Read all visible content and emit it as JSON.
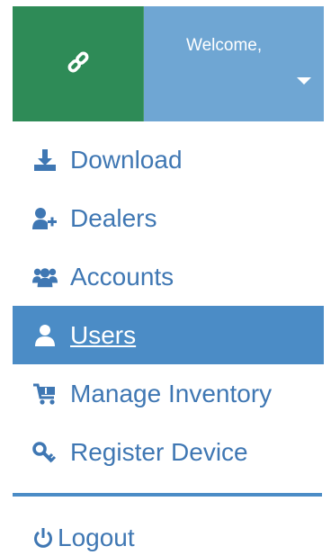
{
  "header": {
    "logo_icon": "link-icon",
    "welcome_text": "Welcome,",
    "dropdown_icon": "caret-down-icon"
  },
  "colors": {
    "logo_bg": "#2e8b57",
    "header_bg": "#6fa6d3",
    "active_bg": "#4b8cc6",
    "link_text": "#3f77b3"
  },
  "menu": {
    "items": [
      {
        "label": "Download",
        "icon": "download-icon",
        "active": false
      },
      {
        "label": "Dealers",
        "icon": "user-plus-icon",
        "active": false
      },
      {
        "label": "Accounts",
        "icon": "users-group-icon",
        "active": false
      },
      {
        "label": "Users",
        "icon": "user-icon",
        "active": true
      },
      {
        "label": "Manage Inventory",
        "icon": "cart-icon",
        "active": false
      },
      {
        "label": "Register Device",
        "icon": "key-icon",
        "active": false
      }
    ]
  },
  "logout": {
    "label": "Logout",
    "icon": "power-icon"
  }
}
